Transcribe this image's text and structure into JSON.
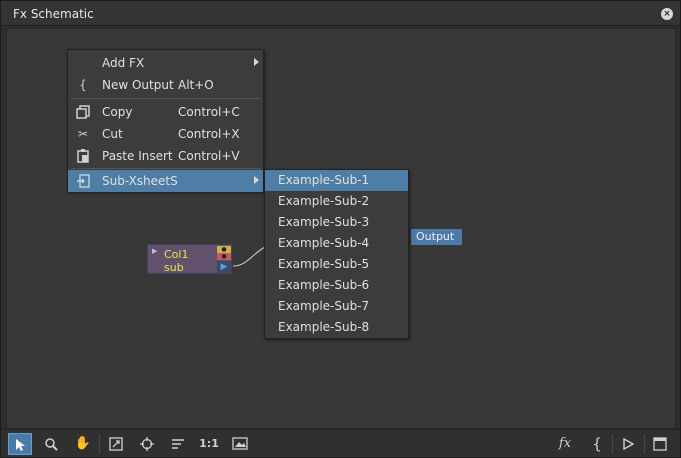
{
  "window": {
    "title": "Fx Schematic",
    "close_glyph": "×"
  },
  "nodes": {
    "column": {
      "name_line1": "Col1",
      "name_line2": "sub",
      "color": "#62516d"
    },
    "output": {
      "label": "Output",
      "color": "#4b7aa8"
    }
  },
  "context_menu": {
    "items": [
      {
        "label": "Add FX",
        "shortcut": "",
        "icon": "",
        "submenu": true
      },
      {
        "label": "New Output",
        "shortcut": "Alt+O",
        "icon": "output-icon",
        "submenu": false
      },
      {
        "label": "Copy",
        "shortcut": "Control+C",
        "icon": "copy-icon",
        "submenu": false
      },
      {
        "label": "Cut",
        "shortcut": "Control+X",
        "icon": "scissors-icon",
        "submenu": false
      },
      {
        "label": "Paste Insert",
        "shortcut": "Control+V",
        "icon": "paste-icon",
        "submenu": false
      },
      {
        "label": "Sub-XsheetS",
        "shortcut": "",
        "icon": "subxsheet-icon",
        "submenu": true,
        "highlighted": true
      }
    ]
  },
  "submenu": {
    "items": [
      {
        "label": "Example-Sub-1",
        "highlighted": true
      },
      {
        "label": "Example-Sub-2"
      },
      {
        "label": "Example-Sub-3"
      },
      {
        "label": "Example-Sub-4"
      },
      {
        "label": "Example-Sub-5"
      },
      {
        "label": "Example-Sub-6"
      },
      {
        "label": "Example-Sub-7"
      },
      {
        "label": "Example-Sub-8"
      }
    ]
  },
  "toolbar": {
    "left": [
      {
        "icon": "selection-arrow-icon",
        "active": true
      },
      {
        "icon": "zoom-icon"
      },
      {
        "icon": "hand-icon"
      },
      {
        "icon": "fit-to-window-icon"
      },
      {
        "icon": "focus-on-current-icon"
      },
      {
        "icon": "reorder-nodes-icon"
      },
      {
        "icon": "actual-size-icon",
        "text": "1:1"
      },
      {
        "icon": "preview-icon"
      }
    ],
    "right": [
      {
        "icon": "fx-icon",
        "text": "fx"
      },
      {
        "icon": "output-icon"
      },
      {
        "icon": "play-icon"
      },
      {
        "icon": "window-toggle-icon"
      }
    ],
    "accent": "#4a7aaa"
  }
}
